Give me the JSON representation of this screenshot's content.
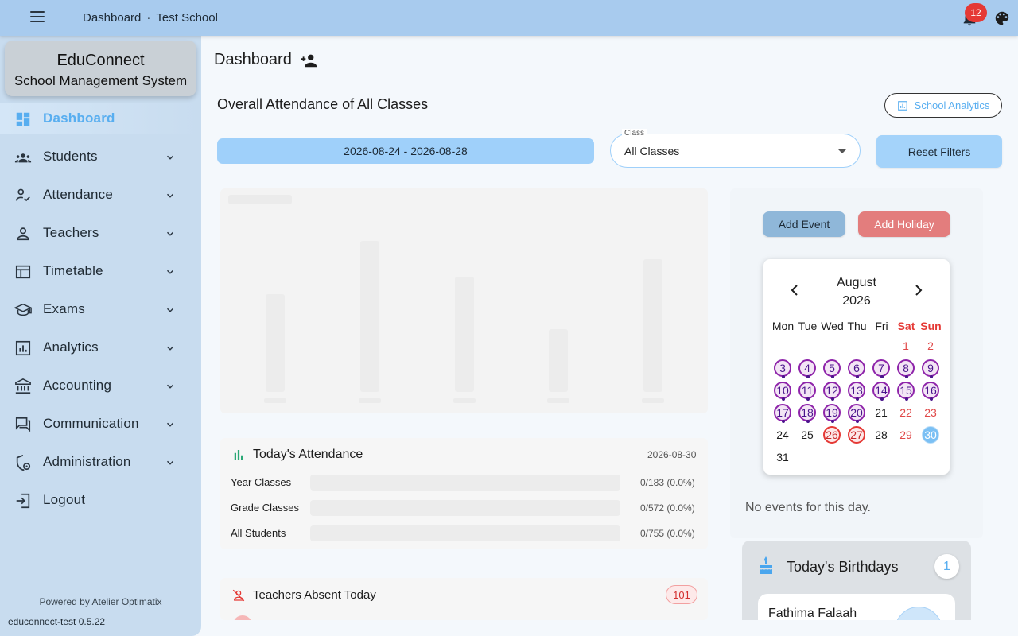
{
  "topbar": {
    "crumb_page": "Dashboard",
    "crumb_sep": "·",
    "crumb_school": "Test School",
    "notifications_count": "12",
    "icons": [
      "menu-icon",
      "bell-icon",
      "palette-icon"
    ]
  },
  "sidebar": {
    "brand_title": "EduConnect",
    "brand_subtitle": "School Management System",
    "items": [
      {
        "label": "Dashboard",
        "icon": "dashboard-icon",
        "active": true
      },
      {
        "label": "Students",
        "icon": "students-icon"
      },
      {
        "label": "Attendance",
        "icon": "attendance-icon"
      },
      {
        "label": "Teachers",
        "icon": "teachers-icon"
      },
      {
        "label": "Timetable",
        "icon": "timetable-icon"
      },
      {
        "label": "Exams",
        "icon": "exams-icon"
      },
      {
        "label": "Analytics",
        "icon": "analytics-icon"
      },
      {
        "label": "Accounting",
        "icon": "accounting-icon"
      },
      {
        "label": "Communication",
        "icon": "communication-icon"
      },
      {
        "label": "Administration",
        "icon": "administration-icon"
      },
      {
        "label": "Logout",
        "icon": "logout-icon"
      }
    ],
    "powered_by": "Powered by Atelier Optimatix",
    "version": "educonnect-test 0.5.22"
  },
  "main": {
    "page_title": "Dashboard",
    "section_title": "Overall Attendance of All Classes",
    "analytics_button": "School Analytics",
    "date_range": "2026-08-24 - 2026-08-28",
    "class_select_label": "Class",
    "class_select_value": "All Classes",
    "reset_button": "Reset Filters"
  },
  "attendance_today": {
    "title": "Today's Attendance",
    "date": "2026-08-30",
    "rows": [
      {
        "name": "Year Classes",
        "stat": "0/183 (0.0%)"
      },
      {
        "name": "Grade Classes",
        "stat": "0/572 (0.0%)"
      },
      {
        "name": "All Students",
        "stat": "0/755 (0.0%)"
      }
    ]
  },
  "teachers_absent": {
    "title": "Teachers Absent Today",
    "count": "101"
  },
  "calendar": {
    "add_event": "Add Event",
    "add_holiday": "Add Holiday",
    "month": "August",
    "year": "2026",
    "weekdays": [
      "Mon",
      "Tue",
      "Wed",
      "Thu",
      "Fri",
      "Sat",
      "Sun"
    ],
    "first_weekday_index": 5,
    "days_in_month": 31,
    "event_days": [
      3,
      4,
      5,
      6,
      7,
      8,
      9,
      10,
      11,
      12,
      13,
      14,
      15,
      16,
      17,
      18,
      19,
      20
    ],
    "holiday_days": [
      26,
      27
    ],
    "today": 30,
    "no_events": "No events for this day.",
    "colors": {
      "event": "#8e24aa",
      "holiday": "#e53935",
      "today": "#7bc0f4"
    }
  },
  "birthdays": {
    "title": "Today's Birthdays",
    "count": "1",
    "people": [
      {
        "name": "Fathima Falaah"
      }
    ]
  },
  "colors": {
    "topbar": "#a8cbee",
    "sidebar": "#c8dcef",
    "accent": "#58aef0",
    "danger": "#e53935"
  }
}
